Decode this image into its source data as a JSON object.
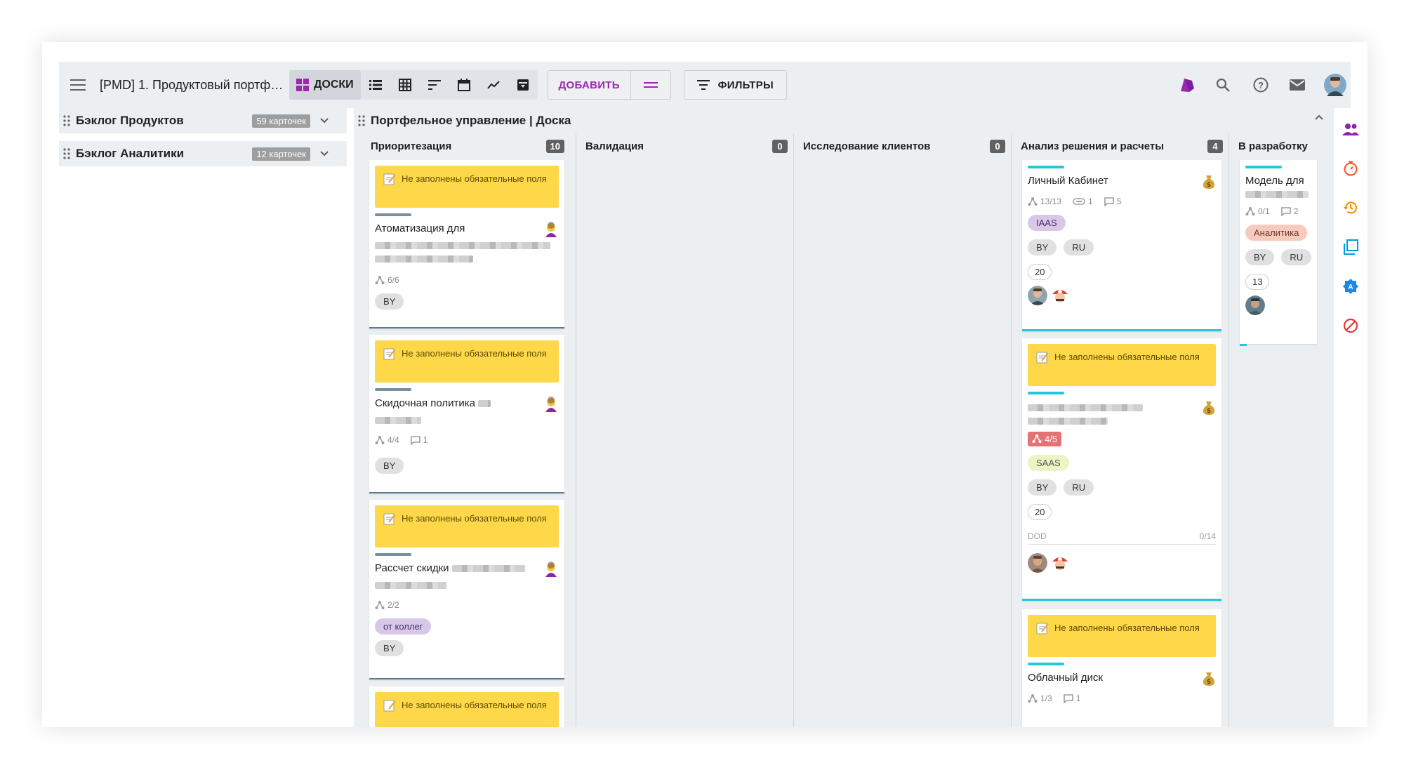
{
  "topbar": {
    "title": "[PMD] 1. Продуктовый портф…",
    "view_active_label": "ДОСКИ",
    "add_label": "ДОБАВИТЬ",
    "filters_label": "ФИЛЬТРЫ",
    "icons": [
      "menu-icon",
      "boards-icon",
      "list-view-icon",
      "table-view-icon",
      "gantt-icon",
      "calendar-icon",
      "chart-icon",
      "archive-icon",
      "equals-icon",
      "filter-icon",
      "brand-logo-icon",
      "search-icon",
      "help-icon",
      "mail-icon",
      "user-avatar"
    ]
  },
  "backlogs": [
    {
      "label": "Бэклог Продуктов",
      "count": "59 карточек"
    },
    {
      "label": "Бэклог Аналитики",
      "count": "12 карточек"
    }
  ],
  "board": {
    "title": "Портфельное управление | Доска",
    "columns": [
      {
        "name": "Приоритезация",
        "count": "10"
      },
      {
        "name": "Валидация",
        "count": "0"
      },
      {
        "name": "Исследование клиентов",
        "count": "0"
      },
      {
        "name": "Анализ решения и расчеты",
        "count": "4"
      },
      {
        "name": "В разработку",
        "count": ""
      }
    ],
    "warning_text": "Не заполнены обязательные поля",
    "cards": {
      "c1": {
        "title": "Атоматизация для",
        "subtasks": "6/6",
        "tags": [
          "BY"
        ]
      },
      "c2": {
        "title": "Скидочная политика",
        "subtasks": "4/4",
        "comments": "1",
        "tags": [
          "BY"
        ]
      },
      "c3": {
        "title": "Рассчет скидки",
        "subtasks": "2/2",
        "tags": [
          "от коллег",
          "BY"
        ]
      },
      "c4": {
        "title": "Личный Кабинет",
        "subtasks": "13/13",
        "attachments": "1",
        "comments": "5",
        "tags": [
          "IAAS",
          "BY",
          "RU"
        ],
        "number": "20"
      },
      "c5": {
        "subtasks": "4/5",
        "tags": [
          "SAAS",
          "BY",
          "RU"
        ],
        "number": "20",
        "dod_label": "DOD",
        "dod_value": "0/14"
      },
      "c6": {
        "title": "Облачный диск",
        "subtasks": "1/3",
        "comments": "1"
      },
      "c7": {
        "title": "Модель для",
        "subtasks": "0/1",
        "comments": "2",
        "tags": [
          "Аналитика",
          "BY",
          "RU"
        ],
        "number": "13"
      }
    }
  },
  "colors": {
    "accent": "#9c27b0",
    "warning": "#ffd84a",
    "cyan": "#26c6da",
    "slate": "#5c7b8a",
    "board_bg": "#eceff1"
  }
}
